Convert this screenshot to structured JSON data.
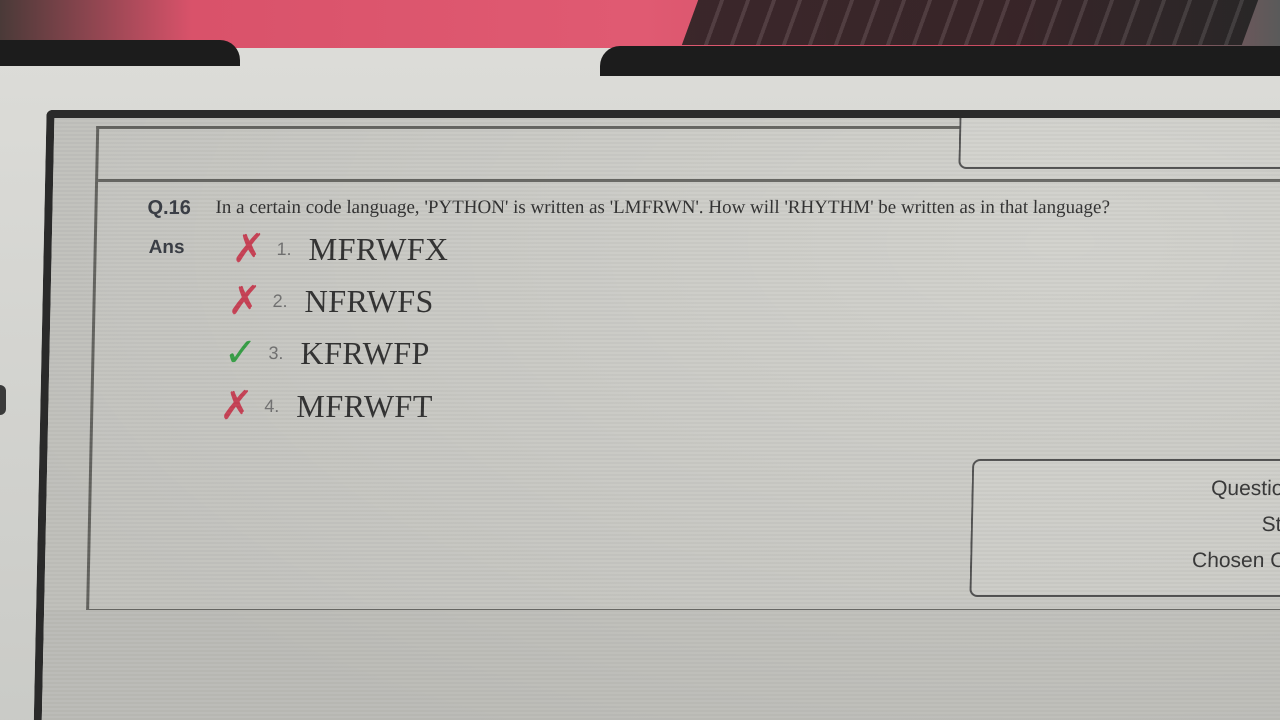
{
  "question": {
    "number": "Q.16",
    "text": "In a certain code language, 'PYTHON' is written as 'LMFRWN'. How will 'RHYTHM' be written as in that language?"
  },
  "answer_label": "Ans",
  "options": [
    {
      "num": "1.",
      "text": "MFRWFX",
      "mark": "✗",
      "status": "incorrect"
    },
    {
      "num": "2.",
      "text": "NFRWFS",
      "mark": "✗",
      "status": "incorrect"
    },
    {
      "num": "3.",
      "text": "KFRWFP",
      "mark": "✓",
      "status": "correct"
    },
    {
      "num": "4.",
      "text": "MFRWFT",
      "mark": "✗",
      "status": "incorrect"
    }
  ],
  "info": {
    "question_id_label": "Question ID :",
    "status_label": "Status :",
    "chosen_option_label": "Chosen Option"
  },
  "colors": {
    "incorrect": "#d2455a",
    "correct": "#3aa84a"
  }
}
